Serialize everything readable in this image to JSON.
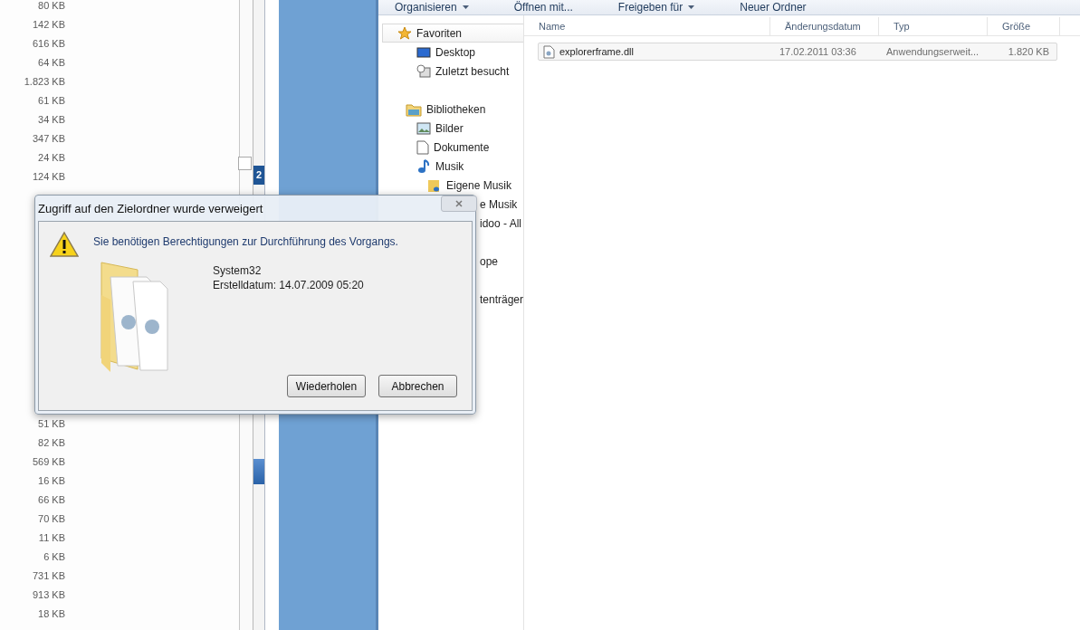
{
  "left_pane": {
    "sizes_top": [
      "80 KB",
      "142 KB",
      "616 KB",
      "64 KB",
      "1.823 KB",
      "61 KB",
      "34 KB",
      "347 KB",
      "24 KB",
      "124 KB"
    ],
    "sizes_bottom": [
      "51 KB",
      "82 KB",
      "569 KB",
      "16 KB",
      "66 KB",
      "70 KB",
      "11 KB",
      "6 KB",
      "731 KB",
      "913 KB",
      "18 KB"
    ]
  },
  "side_strip": {
    "badge": "2"
  },
  "toolbar": [
    {
      "label": "Organisieren",
      "menu": true
    },
    {
      "label": "Öffnen mit...",
      "menu": false
    },
    {
      "label": "Freigeben für",
      "menu": true
    },
    {
      "label": "Neuer Ordner",
      "menu": false
    }
  ],
  "nav": [
    {
      "kind": "group",
      "label": "Favoriten",
      "selected": true,
      "children": [
        {
          "kind": "item",
          "label": "Desktop"
        },
        {
          "kind": "item",
          "label": "Zuletzt besucht"
        }
      ]
    },
    {
      "kind": "group",
      "label": "Bibliotheken",
      "selected": false,
      "children": [
        {
          "kind": "item",
          "label": "Bilder"
        },
        {
          "kind": "item",
          "label": "Dokumente"
        },
        {
          "kind": "item",
          "label": "Musik",
          "children": [
            {
              "kind": "item",
              "label": "Eigene Musik"
            },
            {
              "kind": "partial",
              "label": "e Musik"
            },
            {
              "kind": "partial",
              "label": "idoo - All"
            },
            {
              "kind": "gap"
            },
            {
              "kind": "partial",
              "label": "ope"
            },
            {
              "kind": "gap"
            },
            {
              "kind": "partial",
              "label": "tenträger"
            }
          ]
        }
      ]
    }
  ],
  "file_list": {
    "columns": [
      "Name",
      "Änderungsdatum",
      "Typ",
      "Größe"
    ],
    "rows": [
      {
        "name": "explorerframe.dll",
        "date": "17.02.2011 03:36",
        "type": "Anwendungserweit...",
        "size": "1.820 KB",
        "selected": true
      }
    ]
  },
  "dialog": {
    "title": "Zugriff auf den Zielordner wurde verweigert",
    "message": "Sie benötigen Berechtigungen zur Durchführung des Vorgangs.",
    "item_name": "System32",
    "item_detail": "Erstelldatum: 14.07.2009 05:20",
    "buttons": [
      "Wiederholen",
      "Abbrechen"
    ]
  }
}
